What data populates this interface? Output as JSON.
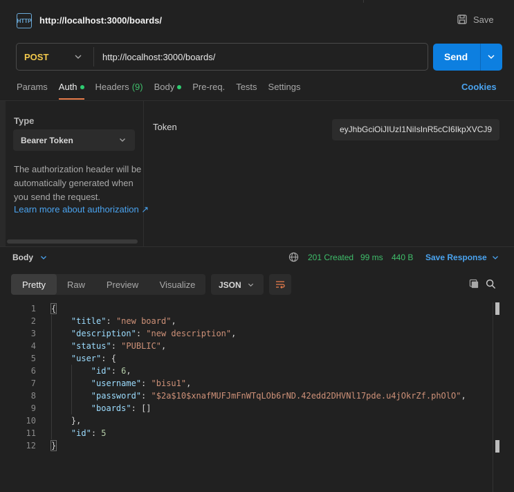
{
  "request": {
    "title": "http://localhost:3000/boards/",
    "save_label": "Save",
    "method": "POST",
    "url": "http://localhost:3000/boards/",
    "send_label": "Send"
  },
  "tabs": [
    {
      "label": "Params"
    },
    {
      "label": "Auth"
    },
    {
      "label": "Headers",
      "count": "(9)"
    },
    {
      "label": "Body"
    },
    {
      "label": "Pre-req."
    },
    {
      "label": "Tests"
    },
    {
      "label": "Settings"
    }
  ],
  "cookies_label": "Cookies",
  "auth": {
    "type_label": "Type",
    "type_value": "Bearer Token",
    "description": "The authorization header will be automatically generated when you send the request.",
    "link": "Learn more about authorization ↗",
    "token_label": "Token",
    "token_value": "eyJhbGciOiJIUzI1NiIsInR5cCI6IkpXVCJ9"
  },
  "response": {
    "body_label": "Body",
    "status": "201 Created",
    "time": "99 ms",
    "size": "440 B",
    "save_label": "Save Response",
    "view_tabs": [
      "Pretty",
      "Raw",
      "Preview",
      "Visualize"
    ],
    "format": "JSON"
  },
  "code_lines": [
    "{",
    "    \"title\": \"new board\",",
    "    \"description\": \"new description\",",
    "    \"status\": \"PUBLIC\",",
    "    \"user\": {",
    "        \"id\": 6,",
    "        \"username\": \"bisu1\",",
    "        \"password\": \"$2a$10$xnafMUFJmFnWTqLOb6rND.42edd2DHVNl17pde.u4jOkrZf.phOlO\",",
    "        \"boards\": []",
    "    },",
    "    \"id\": 5",
    "}"
  ],
  "colors": {
    "accent": "#0d7fe0",
    "method": "#f2c94c",
    "success": "#3fbf6b",
    "link": "#4aa3ef",
    "active_tab": "#e97d4b"
  }
}
